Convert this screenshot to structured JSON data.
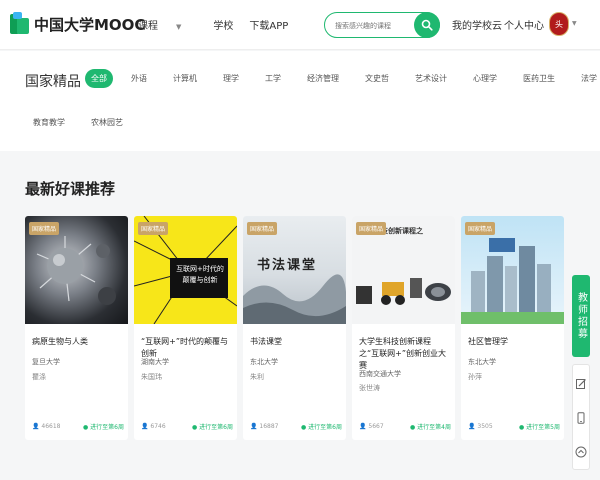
{
  "header": {
    "logo_text": "中国大学MOOC",
    "nav": [
      {
        "label": "课程",
        "has_caret": true
      },
      {
        "label": "学校",
        "has_caret": false
      },
      {
        "label": "下载APP",
        "has_caret": false
      }
    ],
    "search_placeholder": "搜索感兴趣的课程",
    "my_school": "我的学校云",
    "personal": "个人中心",
    "avatar_text": "头"
  },
  "categories": {
    "title": "国家精品",
    "row1": [
      "全部",
      "外语",
      "计算机",
      "理学",
      "工学",
      "经济管理",
      "文史哲",
      "艺术设计",
      "心理学",
      "医药卫生",
      "法学"
    ],
    "row2": [
      "教育教学",
      "农林园艺"
    ],
    "active_index": 0
  },
  "section": {
    "title": "最新好课推荐"
  },
  "cards": [
    {
      "badge": "国家精品",
      "title": "病原生物与人类",
      "school": "复旦大学",
      "teacher": "瞿涤",
      "learners": "46618",
      "status": "进行至第6周"
    },
    {
      "badge": "国家精品",
      "title": "“互联网+”时代的颠覆与创新",
      "school": "湖南大学",
      "teacher": "朱国玮",
      "learners": "6746",
      "status": "进行至第6周",
      "thumb_text": [
        "互联网+时代的",
        "颠覆与创新"
      ]
    },
    {
      "badge": "国家精品",
      "title": "书法课堂",
      "school": "东北大学",
      "teacher": "朱利",
      "learners": "16887",
      "status": "进行至第6周",
      "thumb_text": [
        "书法课堂"
      ]
    },
    {
      "badge": "国家精品",
      "title": "大学生科技创新课程之“互联网+”创新创业大赛",
      "school": "西南交通大学",
      "teacher": "张世涛",
      "learners": "5667",
      "status": "进行至第4周",
      "thumb_text": [
        "科技创新课程之"
      ]
    },
    {
      "badge": "国家精品",
      "title": "社区管理学",
      "school": "东北大学",
      "teacher": "孙萍",
      "learners": "3505",
      "status": "进行至第5周"
    }
  ],
  "float": {
    "green_label": "教师招募"
  },
  "colors": {
    "accent": "#1fb870",
    "badge": "#c9a467"
  },
  "icons": [
    "search-icon",
    "user-icon",
    "edit-icon",
    "phone-icon",
    "back-to-top-icon"
  ]
}
